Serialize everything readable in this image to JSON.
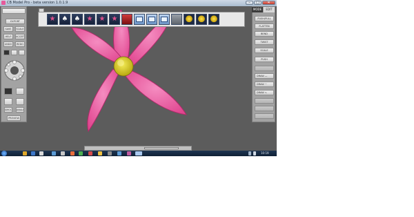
{
  "window": {
    "title": "CB Model Pro - beta version 1.0.1.9",
    "minimize_glyph": "–",
    "maximize_glyph": "□",
    "close_glyph": "✕"
  },
  "left_panel": {
    "top_button": "",
    "buttons": [
      "EXPORT",
      "SAVE",
      "SCALE",
      "HELP",
      "ACCEPT",
      "UNDO",
      "REDO"
    ],
    "secondary_buttons": [
      "SMOOTH",
      "ANALY"
    ],
    "bottom_button": "PREVIEW"
  },
  "right_panel": {
    "tabs": [
      "MODE",
      "EDIT"
    ],
    "buttons": [
      "PUSH/PULL",
      "FLATTEN",
      "BEND",
      "TWIST",
      "SCALE",
      "PUSH",
      "DRAW",
      "DRAW",
      "DRAW"
    ]
  },
  "toolbar": {
    "tools": [
      "slider",
      "star",
      "drop",
      "drop",
      "star",
      "star",
      "star",
      "flat",
      "window",
      "window",
      "window",
      "flat",
      "ball",
      "ball",
      "ball"
    ]
  },
  "scene": {
    "object": "pink flower",
    "petal_color": "#ee5b9f",
    "center_color": "#e2d62a",
    "background_color": "#5c5c5c"
  },
  "taskbar": {
    "clock": "10:19"
  }
}
